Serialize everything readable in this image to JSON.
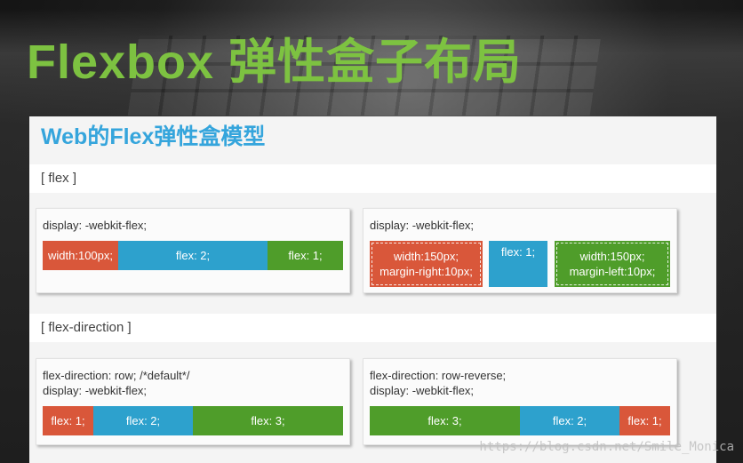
{
  "slide": {
    "title": "Flexbox 弹性盒子布局",
    "panel_title": "Web的Flex弹性盒模型"
  },
  "sections": {
    "flex_label": "[ flex ]",
    "direction_label": "[ flex-direction ]"
  },
  "flex_examples": {
    "left": {
      "code": "display: -webkit-flex;",
      "items": [
        "width:100px;",
        "flex: 2;",
        "flex: 1;"
      ]
    },
    "right": {
      "code": "display: -webkit-flex;",
      "items": [
        "width:150px;\nmargin-right:10px;",
        "flex: 1;",
        "width:150px;\nmargin-left:10px;"
      ]
    }
  },
  "direction_examples": {
    "left": {
      "code": "flex-direction: row; /*default*/\ndisplay: -webkit-flex;",
      "items": [
        "flex: 1;",
        "flex: 2;",
        "flex: 3;"
      ]
    },
    "right": {
      "code": "flex-direction: row-reverse;\ndisplay: -webkit-flex;",
      "items": [
        "flex: 3;",
        "flex: 2;",
        "flex: 1;"
      ]
    }
  },
  "watermark": "https://blog.csdn.net/Smile_Monica",
  "colors": {
    "title_green": "#7dc241",
    "panel_title_blue": "#35a5dc",
    "item_red": "#d9573a",
    "item_blue": "#2da1cd",
    "item_green": "#4f9d2a"
  }
}
